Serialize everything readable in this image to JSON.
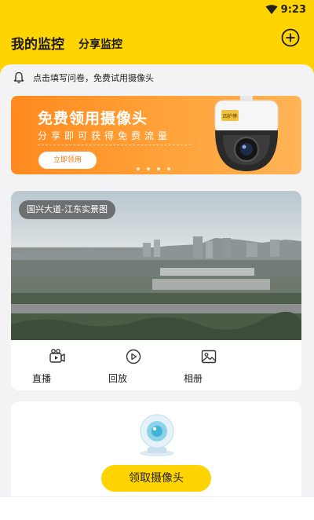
{
  "status_bar": {
    "time": "9:23"
  },
  "header": {
    "title": "我的监控",
    "subtitle": "分享监控"
  },
  "notice": {
    "text": "点击填写问卷，免费试用摄像头"
  },
  "banner": {
    "title": "免费领用摄像头",
    "subtitle": "分享即可获得免费流量",
    "button": "立即领用",
    "brand": "四护博",
    "page_count": 4,
    "active_page": 1
  },
  "monitor": {
    "location": "国兴大道-江东实景图",
    "actions": [
      {
        "label": "直播",
        "icon": "live-video-icon"
      },
      {
        "label": "回放",
        "icon": "play-circle-icon"
      },
      {
        "label": "相册",
        "icon": "image-icon"
      }
    ]
  },
  "claim": {
    "button": "领取摄像头"
  },
  "colors": {
    "accent": "#ffd400",
    "banner_orange": "#ff8a1f"
  }
}
